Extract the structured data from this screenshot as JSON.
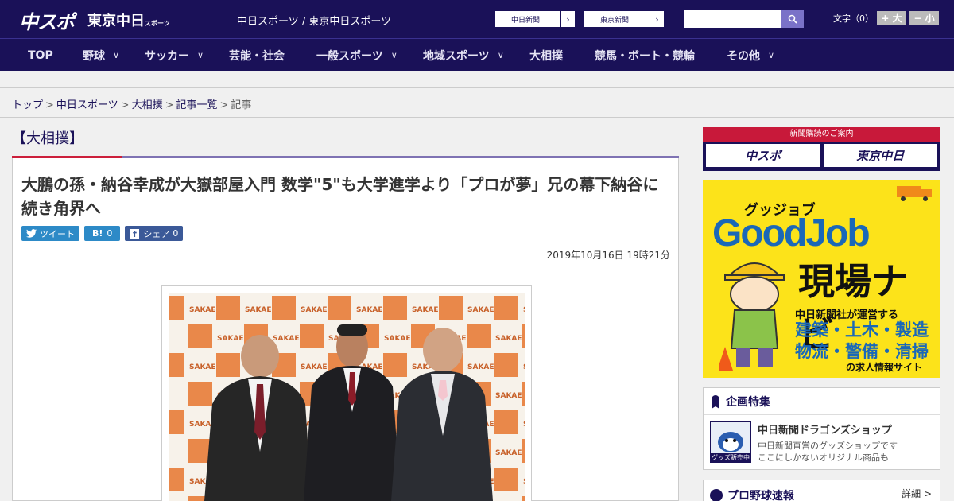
{
  "header": {
    "logo_main": "中スポ",
    "logo_sub": "東京中日",
    "logo_sub_small": "スポーツ",
    "site_name": "中日スポーツ / 東京中日スポーツ",
    "paper_selectors": [
      "中日新聞",
      "東京新聞"
    ],
    "search_placeholder": "",
    "font_size_label": "文字（0）",
    "font_larger": "+ 大",
    "font_smaller": "− 小"
  },
  "nav": [
    {
      "label": "TOP",
      "has_menu": false
    },
    {
      "label": "野球",
      "has_menu": true
    },
    {
      "label": "サッカー",
      "has_menu": true
    },
    {
      "label": "芸能・社会",
      "has_menu": false
    },
    {
      "label": "一般スポーツ",
      "has_menu": true
    },
    {
      "label": "地域スポーツ",
      "has_menu": true
    },
    {
      "label": "大相撲",
      "has_menu": false
    },
    {
      "label": "競馬・ボート・競輪",
      "has_menu": false
    },
    {
      "label": "その他",
      "has_menu": true
    }
  ],
  "breadcrumb": [
    "トップ",
    "中日スポーツ",
    "大相撲",
    "記事一覧",
    "記事"
  ],
  "article": {
    "category": "【大相撲】",
    "title": "大鵬の孫・納谷幸成が大嶽部屋入門 数学\"5\"も大学進学より「プロが夢」兄の幕下納谷に続き角界へ",
    "share": {
      "tweet": "ツイート",
      "hatena": "B!",
      "hatena_count": "0",
      "facebook": "シェア",
      "facebook_count": "0"
    },
    "date": "2019年10月16日 19時21分",
    "photo_backdrop_text": "SAKAE"
  },
  "sidebar": {
    "subscribe_header": "新聞購読のご案内",
    "subscribe_links": [
      "中スポ",
      "東京中日"
    ],
    "ad": {
      "kana": "グッジョブ",
      "brand": "GoodJob",
      "name": "現場ナビ",
      "operator": "中日新聞社が運営する",
      "fields_line1": "建築・土木・製造",
      "fields_line2": "物流・警備・清掃",
      "tagline": "の求人情報サイト"
    },
    "feature": {
      "heading": "企画特集",
      "thumb_label": "グッズ販売中",
      "title": "中日新聞ドラゴンズショップ",
      "desc_line1": "中日新聞直営のグッズショップです",
      "desc_line2": "ここにしかないオリジナル商品も"
    },
    "baseball": {
      "heading": "プロ野球速報",
      "more": "詳細 >"
    }
  },
  "colors": {
    "brand_navy": "#1a1158",
    "accent_red": "#cc1f3b",
    "ad_yellow": "#fce31a"
  }
}
